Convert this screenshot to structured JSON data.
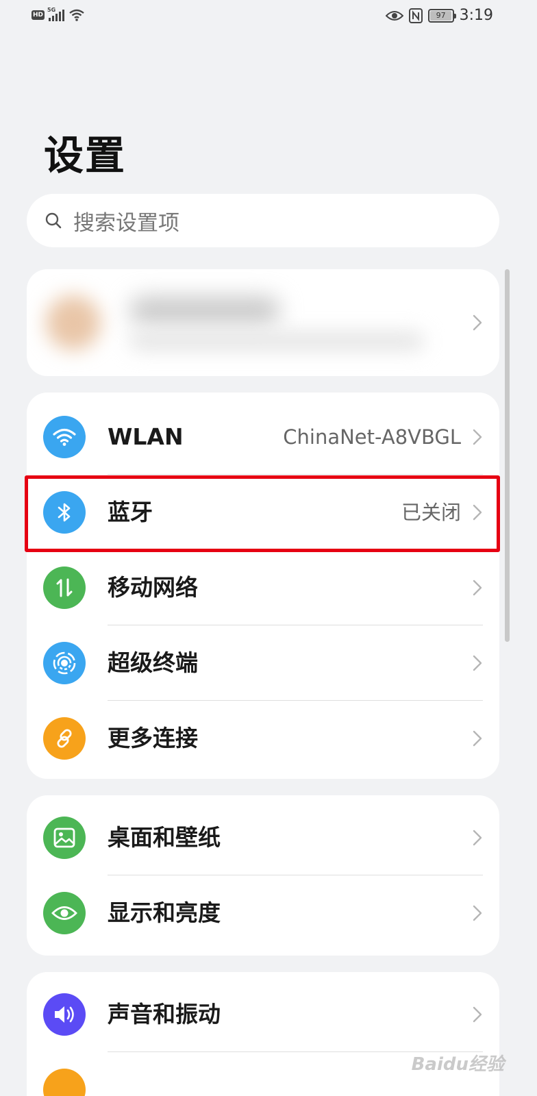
{
  "status_bar": {
    "hd": "HD",
    "network": "5G",
    "battery": "97",
    "battery_level": 0.97,
    "time": "3:19"
  },
  "title": "设置",
  "search": {
    "placeholder": "搜索设置项"
  },
  "account_card": {
    "blurred": true
  },
  "connectivity": [
    {
      "label": "WLAN",
      "value": "ChinaNet-A8VBGL",
      "icon": "wifi-icon",
      "color": "#3aa6f0"
    },
    {
      "label": "蓝牙",
      "value": "已关闭",
      "icon": "bluetooth-icon",
      "color": "#3aa6f0",
      "highlighted": true
    },
    {
      "label": "移动网络",
      "value": "",
      "icon": "mobile-data-icon",
      "color": "#4cb655"
    },
    {
      "label": "超级终端",
      "value": "",
      "icon": "super-device-icon",
      "color": "#3aa6f0"
    },
    {
      "label": "更多连接",
      "value": "",
      "icon": "link-icon",
      "color": "#f7a21b"
    }
  ],
  "display": [
    {
      "label": "桌面和壁纸",
      "icon": "wallpaper-icon",
      "color": "#4cb655"
    },
    {
      "label": "显示和亮度",
      "icon": "eye-icon",
      "color": "#4cb655"
    }
  ],
  "sound": [
    {
      "label": "声音和振动",
      "icon": "speaker-icon",
      "color": "#5b4bf5"
    },
    {
      "label": "",
      "icon": "notification-icon",
      "color": "#f7a21b"
    }
  ],
  "highlight_color": "#e60012",
  "watermark": "Baidu经验"
}
